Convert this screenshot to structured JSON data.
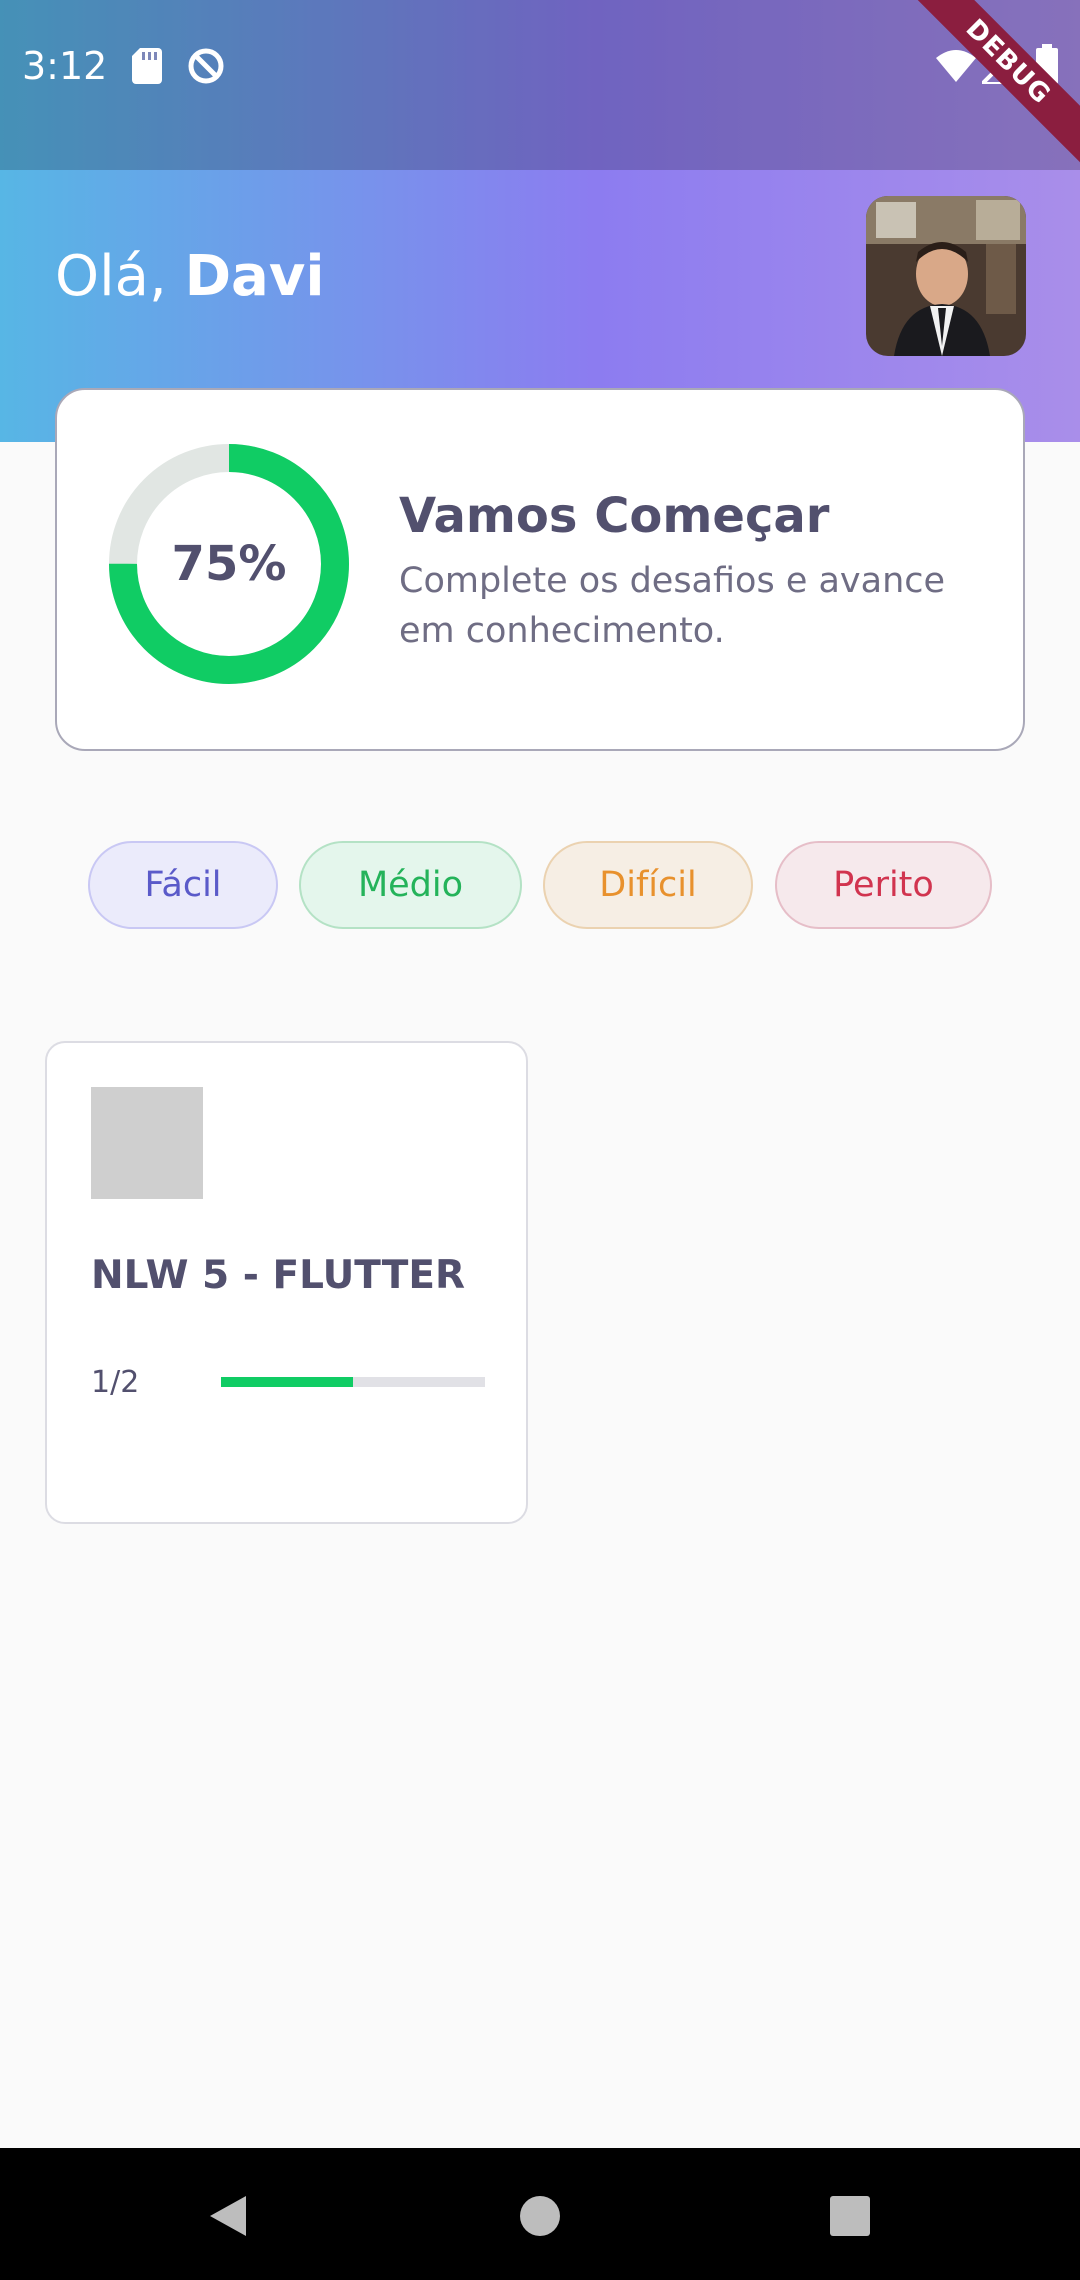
{
  "status_bar": {
    "time": "3:12",
    "icons": [
      "sd-card-icon",
      "data-saver-icon",
      "wifi-icon",
      "signal-icon",
      "battery-icon"
    ],
    "debug_label": "DEBUG"
  },
  "header": {
    "greeting_prefix": "Olá, ",
    "user_name": "Davi",
    "gradient_colors": [
      "#57B6E5",
      "#A98EEA"
    ]
  },
  "score_card": {
    "percent": 0.75,
    "percent_label": "75%",
    "title": "Vamos Começar",
    "subtitle": "Complete os desafios e avance em conhecimento.",
    "ring_color": "#10CC64",
    "ring_track_color": "#E1E6E3"
  },
  "levels": [
    {
      "label": "Fácil"
    },
    {
      "label": "Médio"
    },
    {
      "label": "Difícil"
    },
    {
      "label": "Perito"
    }
  ],
  "quizzes": [
    {
      "title": "NLW 5 - FLUTTER",
      "progress_label": "1/2",
      "progress": 0.5
    }
  ],
  "nav": {
    "icons": [
      "back-icon",
      "home-icon",
      "recents-icon"
    ]
  }
}
